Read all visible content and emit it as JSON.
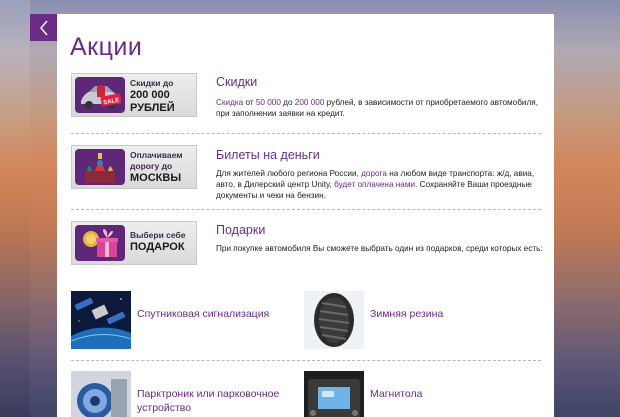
{
  "header": {
    "title": "Акции"
  },
  "promos": [
    {
      "badge_line1": "Скидки до",
      "badge_line2": "200 000",
      "badge_line3": "РУБЛЕЙ",
      "badge_sale": "SALE",
      "title": "Скидки",
      "desc_link1": "Скидка",
      "desc_t1": " от ",
      "desc_link2": "50 000",
      "desc_t2": " до ",
      "desc_link3": "200 000",
      "desc_t3": " рублей, в зависимости от приобретаемого автомобиля, при заполнении заявки на кредит."
    },
    {
      "badge_line1": "Оплачиваем",
      "badge_line2": "дорогу до",
      "badge_line3": "МОСКВЫ",
      "title": "Билеты на деньги",
      "desc_t1": "Для жителей любого региона России, ",
      "desc_link1": "дорога",
      "desc_t2": " на любом виде транспорта: ж/д, авиа, авто, в Дилерский центр Unity, ",
      "desc_link2": "будет оплачена нами",
      "desc_t3": ". Сохраняйте Ваши проездные документы и чеки на бензин."
    },
    {
      "badge_line1": "Выбери себе",
      "badge_line2": "ПОДАРОК",
      "title": "Подарки",
      "desc_t1": "При покупке автомобиля Вы сможете выбрать один из подарков, среди которых есть:"
    }
  ],
  "gifts": [
    {
      "label": "Спутниковая сигнализация",
      "icon": "satellite-icon"
    },
    {
      "label": "Зимняя резина",
      "icon": "tire-icon"
    },
    {
      "label": "Парктроник или парковочное устройство",
      "icon": "parking-sensor-icon"
    },
    {
      "label": "Магнитола",
      "icon": "car-stereo-icon"
    }
  ],
  "colors": {
    "accent": "#6a2c86",
    "panel": "#ffffff",
    "text": "#222222"
  }
}
